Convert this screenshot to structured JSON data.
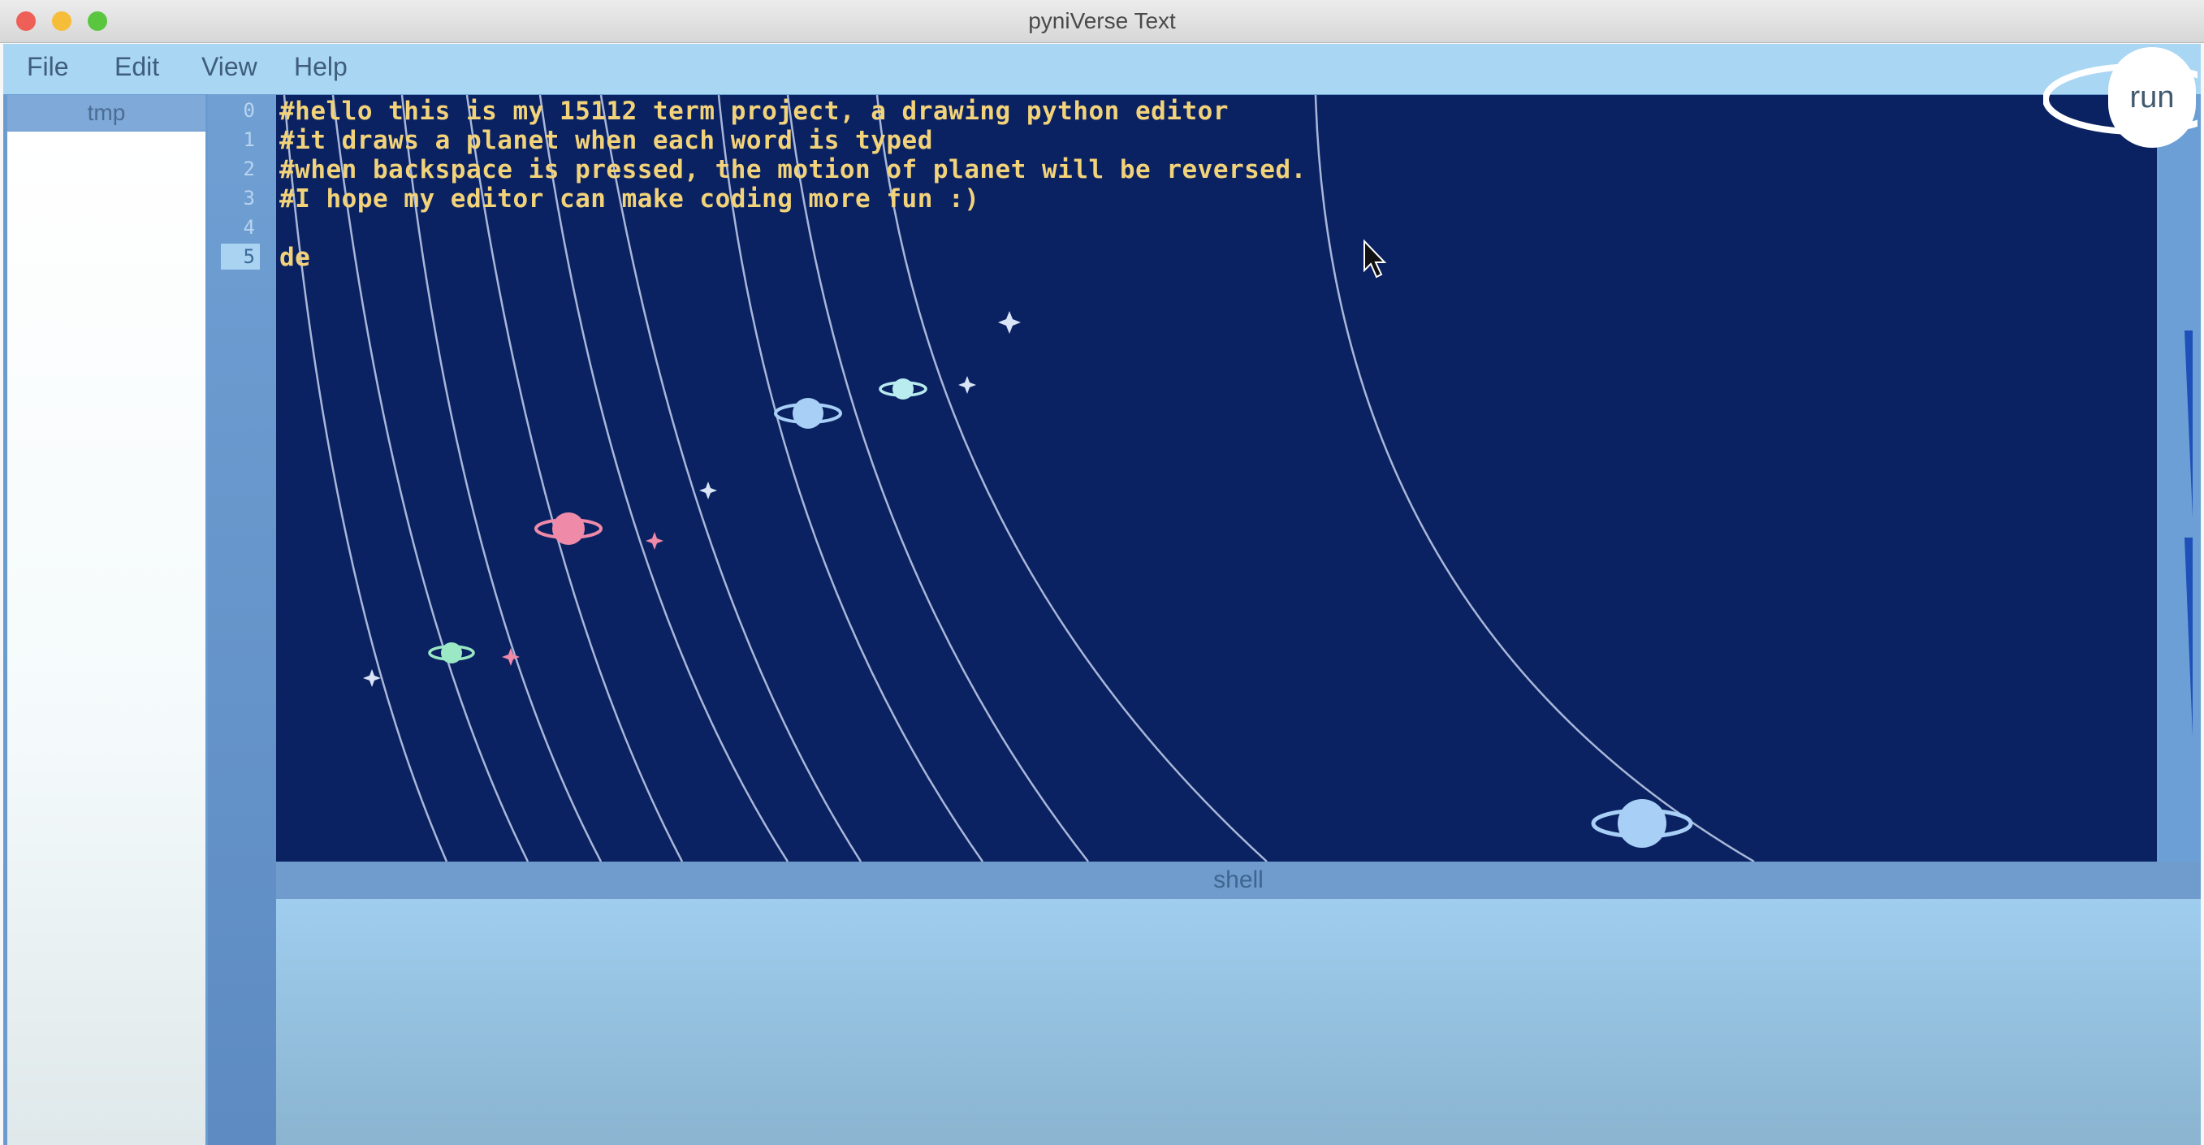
{
  "window": {
    "title": "pyniVerse Text",
    "traffic_lights": [
      "#ee5f58",
      "#f6bd3a",
      "#5ac640"
    ]
  },
  "menu": [
    "File",
    "Edit",
    "View",
    "Help"
  ],
  "file_tab": "tmp",
  "line_numbers": [
    "0",
    "1",
    "2",
    "3",
    "4",
    "5"
  ],
  "active_line": "5",
  "code_lines": [
    "#hello this is my 15112 term project, a drawing python editor",
    "#it draws a planet when each word is typed",
    "#when backspace is pressed, the motion of planet will be reversed.",
    "#I hope my editor can make coding more fun :)",
    "",
    "de"
  ],
  "run_button": "run",
  "shell_label": "shell",
  "colors": {
    "editor_bg": "#0b2262",
    "code_text": "#f2d37a",
    "orbit": "#b9c8e6",
    "planet_blue": "#a8d0f6",
    "planet_pink": "#ef8aa9",
    "planet_green": "#9be8c4",
    "planet_cyan": "#b8ecef"
  },
  "icons": {
    "cursor": "mouse-pointer-icon",
    "planet": "ringed-planet-icon",
    "star": "sparkle-star-icon"
  }
}
